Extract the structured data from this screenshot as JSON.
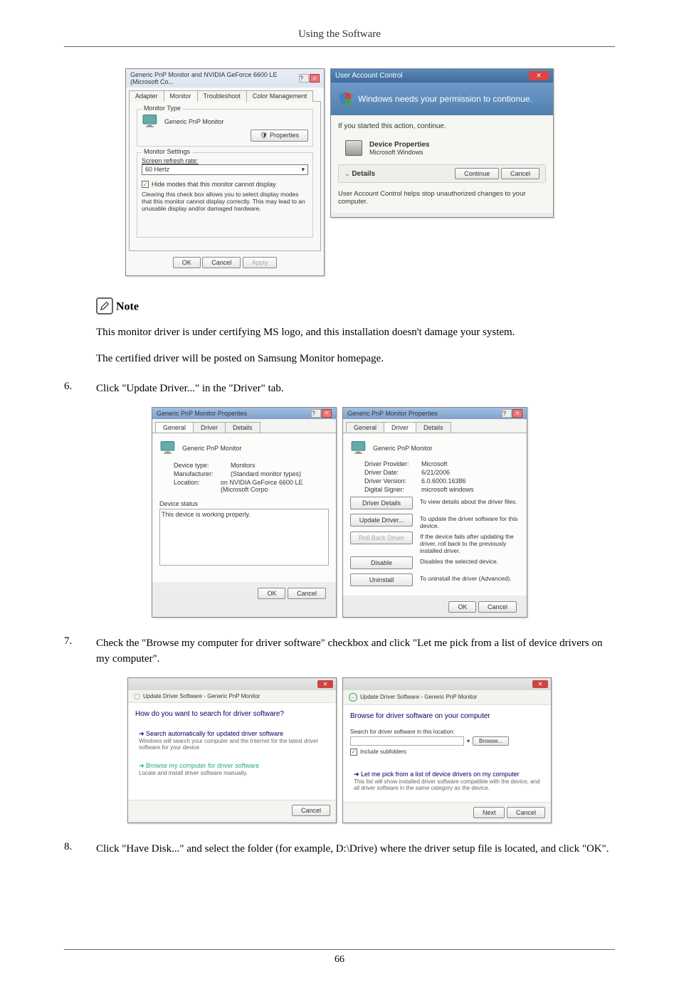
{
  "header": {
    "title": "Using the Software"
  },
  "dialog1": {
    "title": "Generic PnP Monitor and NVIDIA GeForce 6600 LE (Microsoft Co...",
    "tabs": {
      "adapter": "Adapter",
      "monitor": "Monitor",
      "troubleshoot": "Troubleshoot",
      "color": "Color Management"
    },
    "monitor_type_label": "Monitor Type",
    "monitor_name": "Generic PnP Monitor",
    "properties_btn": "Properties",
    "settings_label": "Monitor Settings",
    "refresh_label": "Screen refresh rate:",
    "refresh_value": "60 Hertz",
    "hide_modes": "Hide modes that this monitor cannot display",
    "hide_modes_desc": "Clearing this check box allows you to select display modes that this monitor cannot display correctly. This may lead to an unusable display and/or damaged hardware.",
    "ok": "OK",
    "cancel": "Cancel",
    "apply": "Apply"
  },
  "uac": {
    "title": "User Account Control",
    "banner": "Windows needs your permission to contionue.",
    "prompt": "If you started this action, continue.",
    "device_prop": "Device Properties",
    "ms_windows": "Microsoft Windows",
    "details": "Details",
    "continue": "Continue",
    "cancel": "Cancel",
    "footer": "User Account Control helps stop unauthorized changes to your computer."
  },
  "note": {
    "label": "Note",
    "p1": "This monitor driver is under certifying MS logo, and this installation doesn't damage your system.",
    "p2": "The certified driver will be posted on Samsung Monitor homepage."
  },
  "step6": {
    "num": "6.",
    "text": "Click \"Update Driver...\" in the \"Driver\" tab."
  },
  "propA": {
    "title": "Generic PnP Monitor Properties",
    "tabs": {
      "general": "General",
      "driver": "Driver",
      "details": "Details"
    },
    "icon_label": "Generic PnP Monitor",
    "device_type_l": "Device type:",
    "device_type_v": "Monitors",
    "manufacturer_l": "Manufacturer:",
    "manufacturer_v": "(Standard monitor types)",
    "location_l": "Location:",
    "location_v": "on NVIDIA GeForce 6600 LE (Microsoft Corpo",
    "status_label": "Device status",
    "status_text": "This device is working properly.",
    "ok": "OK",
    "cancel": "Cancel"
  },
  "propB": {
    "title": "Generic PnP Monitor Properties",
    "tabs": {
      "general": "General",
      "driver": "Driver",
      "details": "Details"
    },
    "icon_label": "Generic PnP Monitor",
    "provider_l": "Driver Provider:",
    "provider_v": "Microsoft",
    "date_l": "Driver Date:",
    "date_v": "6/21/2006",
    "version_l": "Driver Version:",
    "version_v": "6.0.6000.16386",
    "signer_l": "Digital Signer:",
    "signer_v": "microsoft windows",
    "btn_details": "Driver Details",
    "desc_details": "To view details about the driver files.",
    "btn_update": "Update Driver...",
    "desc_update": "To update the driver software for this device.",
    "btn_rollback": "Roll Back Driver",
    "desc_rollback": "If the device fails after updating the driver, roll back to the previously installed driver.",
    "btn_disable": "Disable",
    "desc_disable": "Disables the selected device.",
    "btn_uninstall": "Uninstall",
    "desc_uninstall": "To uninstall the driver (Advanced).",
    "ok": "OK",
    "cancel": "Cancel"
  },
  "step7": {
    "num": "7.",
    "text": "Check the \"Browse my computer for driver software\" checkbox and click \"Let me pick from a list of device drivers on my computer\"."
  },
  "wizA": {
    "crumb": "Update Driver Software - Generic PnP Monitor",
    "heading": "How do you want to search for driver software?",
    "opt1_title": "Search automatically for updated driver software",
    "opt1_desc": "Windows will search your computer and the Internet for the latest driver software for your device.",
    "opt2_title": "Browse my computer for driver software",
    "opt2_desc": "Locate and install driver software manually.",
    "cancel": "Cancel"
  },
  "wizB": {
    "crumb": "Update Driver Software - Generic PnP Monitor",
    "heading": "Browse for driver software on your computer",
    "search_label": "Search for driver software in this location:",
    "browse": "Browse...",
    "include": "Include subfolders",
    "opt_title": "Let me pick from a list of device drivers on my computer",
    "opt_desc": "This list will show installed driver software compatible with the device, and all driver software in the same category as the device.",
    "next": "Next",
    "cancel": "Cancel"
  },
  "step8": {
    "num": "8.",
    "text": "Click \"Have Disk...\" and select the folder (for example, D:\\Drive) where the driver setup file is located, and click \"OK\"."
  },
  "pagenum": "66"
}
